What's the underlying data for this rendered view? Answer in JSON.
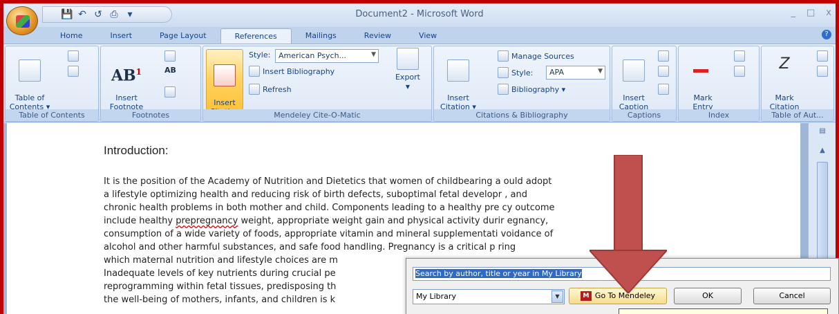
{
  "window": {
    "title": "Document2 - Microsoft Word",
    "controls": [
      "_",
      "□",
      "x"
    ]
  },
  "quick_access": {
    "icons": [
      "save-icon",
      "undo-icon",
      "redo-icon",
      "print-icon"
    ]
  },
  "tabs": [
    {
      "label": "Home",
      "active": false
    },
    {
      "label": "Insert",
      "active": false
    },
    {
      "label": "Page Layout",
      "active": false
    },
    {
      "label": "References",
      "active": true
    },
    {
      "label": "Mailings",
      "active": false
    },
    {
      "label": "Review",
      "active": false
    },
    {
      "label": "View",
      "active": false
    }
  ],
  "ribbon": {
    "toc": {
      "btn": "Table of\nContents ▾",
      "label": "Table of Contents"
    },
    "footnotes": {
      "btn": "Insert\nFootnote",
      "ab": "AB",
      "sup": "1",
      "label": "Footnotes"
    },
    "mendeley": {
      "insert_citation": "Insert\nCitation",
      "style_label": "Style:",
      "style_value": "American Psych...",
      "insert_bibliography": "Insert Bibliography",
      "refresh": "Refresh",
      "export": "Export",
      "label": "Mendeley Cite-O-Matic"
    },
    "citations": {
      "insert_citation": "Insert\nCitation ▾",
      "manage_sources": "Manage Sources",
      "style_label": "Style:",
      "style_value": "APA",
      "bibliography": "Bibliography ▾",
      "label": "Citations & Bibliography"
    },
    "captions": {
      "insert_caption": "Insert\nCaption",
      "label": "Captions"
    },
    "index": {
      "mark_entry": "Mark\nEntry",
      "label": "Index"
    },
    "toa": {
      "mark_citation": "Mark\nCitation",
      "label": "Table of Aut..."
    }
  },
  "document": {
    "heading": "Introduction:",
    "lines": [
      "It is the position of the Academy of Nutrition and Dietetics that women of childbearing a     ould adopt",
      "a lifestyle optimizing health and reducing risk of birth defects, suboptimal fetal developr     , and",
      "chronic health problems in both mother and child. Components leading to a healthy pre       cy outcome",
      "include healthy prepregnancy weight, appropriate weight gain and physical activity durir      egnancy,",
      "consumption of a wide variety of foods, appropriate vitamin and mineral supplementati      voidance of",
      "alcohol and other harmful substances, and safe food handling. Pregnancy is a critical  p         ring",
      "which maternal nutrition and lifestyle choices are m",
      "Inadequate levels of key nutrients during crucial pe",
      "reprogramming within fetal tissues, predisposing th",
      "the well-being of mothers, infants, and children is k"
    ]
  },
  "dialog": {
    "search_placeholder": "Search by author, title or year in My Library",
    "library_value": "My Library",
    "goto_label": "Go To Mendeley",
    "ok_label": "OK",
    "cancel_label": "Cancel"
  },
  "colors": {
    "frame": "#c00000",
    "arrow": "#c0504d",
    "ribbon_bg": "#dfe9f6",
    "highlight": "#ffd25e"
  }
}
